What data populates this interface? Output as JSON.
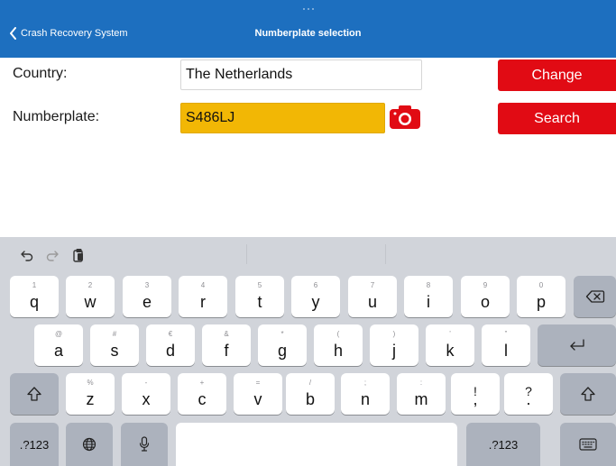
{
  "navbar": {
    "back_label": "Crash Recovery System",
    "title": "Numberplate selection",
    "color": "#1d6fbf"
  },
  "form": {
    "country_label": "Country:",
    "country_value": "The Netherlands",
    "plate_label": "Numberplate:",
    "plate_value": "S486LJ",
    "change_button": "Change",
    "search_button": "Search",
    "button_color": "#e10b14",
    "plate_color": "#f2b705"
  },
  "keyboard": {
    "toolbar": [
      "undo-icon",
      "redo-icon",
      "paste-icon"
    ],
    "row1": [
      {
        "hint": "1",
        "key": "q"
      },
      {
        "hint": "2",
        "key": "w"
      },
      {
        "hint": "3",
        "key": "e"
      },
      {
        "hint": "4",
        "key": "r"
      },
      {
        "hint": "5",
        "key": "t"
      },
      {
        "hint": "6",
        "key": "y"
      },
      {
        "hint": "7",
        "key": "u"
      },
      {
        "hint": "8",
        "key": "i"
      },
      {
        "hint": "9",
        "key": "o"
      },
      {
        "hint": "0",
        "key": "p"
      }
    ],
    "row2": [
      {
        "hint": "@",
        "key": "a"
      },
      {
        "hint": "#",
        "key": "s"
      },
      {
        "hint": "€",
        "key": "d"
      },
      {
        "hint": "&",
        "key": "f"
      },
      {
        "hint": "*",
        "key": "g"
      },
      {
        "hint": "(",
        "key": "h"
      },
      {
        "hint": ")",
        "key": "j"
      },
      {
        "hint": "’",
        "key": "k"
      },
      {
        "hint": "”",
        "key": "l"
      }
    ],
    "row3": [
      {
        "hint": "%",
        "key": "z"
      },
      {
        "hint": "-",
        "key": "x"
      },
      {
        "hint": "+",
        "key": "c"
      },
      {
        "hint": "=",
        "key": "v"
      },
      {
        "hint": "/",
        "key": "b"
      },
      {
        "hint": ";",
        "key": "n"
      },
      {
        "hint": ":",
        "key": "m"
      },
      {
        "hint": "!",
        "key": ","
      },
      {
        "hint": "?",
        "key": "."
      }
    ],
    "numbers_key": ".?123"
  }
}
